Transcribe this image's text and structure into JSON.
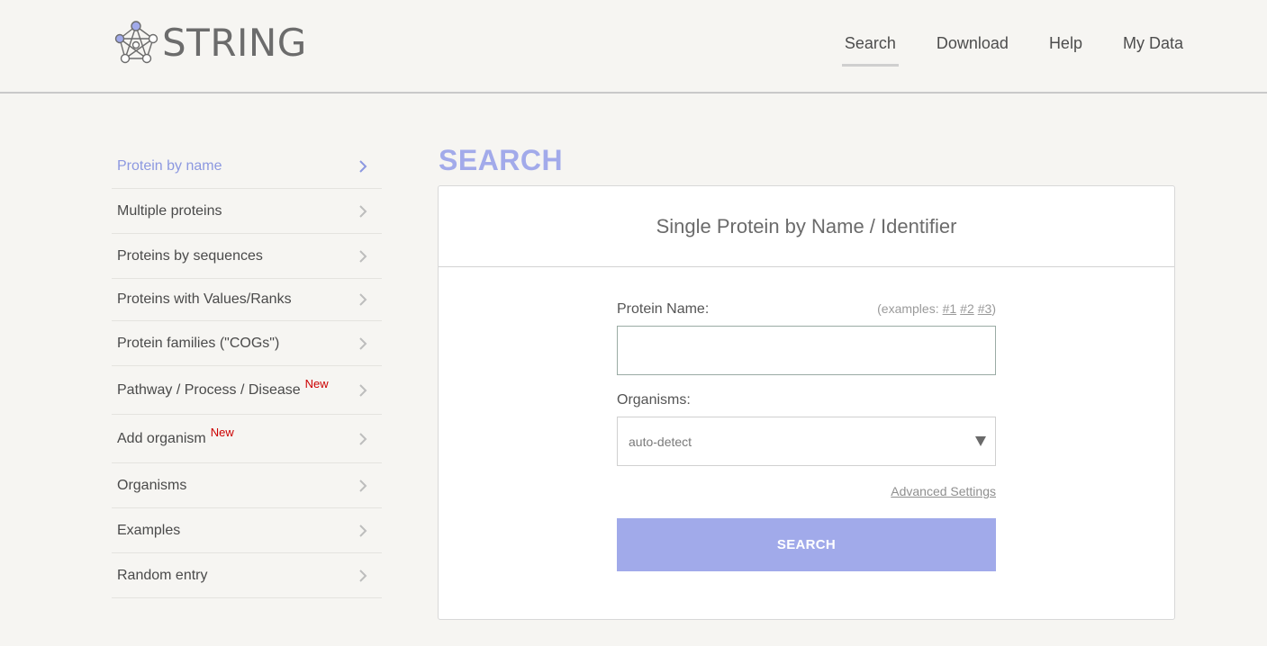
{
  "logo": {
    "text": "STRING"
  },
  "nav": [
    {
      "label": "Search",
      "active": true
    },
    {
      "label": "Download",
      "active": false
    },
    {
      "label": "Help",
      "active": false
    },
    {
      "label": "My Data",
      "active": false
    }
  ],
  "sidebar": {
    "items": [
      {
        "label": "Protein by name",
        "active": true,
        "badge": ""
      },
      {
        "label": "Multiple proteins",
        "active": false,
        "badge": ""
      },
      {
        "label": "Proteins by sequences",
        "active": false,
        "badge": ""
      },
      {
        "label": "Proteins with Values/Ranks",
        "active": false,
        "badge": ""
      },
      {
        "label": "Protein families (\"COGs\")",
        "active": false,
        "badge": ""
      },
      {
        "label": "Pathway / Process / Disease",
        "active": false,
        "badge": "New"
      },
      {
        "label": "Add organism",
        "active": false,
        "badge": "New"
      },
      {
        "label": "Organisms",
        "active": false,
        "badge": ""
      },
      {
        "label": "Examples",
        "active": false,
        "badge": ""
      },
      {
        "label": "Random entry",
        "active": false,
        "badge": ""
      }
    ]
  },
  "main": {
    "title": "SEARCH",
    "card_title": "Single Protein by Name / Identifier",
    "protein_label": "Protein Name:",
    "examples": {
      "prefix": "(examples:",
      "links": [
        "#1",
        "#2",
        "#3"
      ],
      "suffix": ")"
    },
    "protein_input": {
      "value": "",
      "placeholder": ""
    },
    "organisms_label": "Organisms:",
    "organisms_select": {
      "value": "auto-detect"
    },
    "advanced_settings": "Advanced Settings",
    "search_button": "SEARCH"
  },
  "colors": {
    "accent": "#a1aaea",
    "active_link": "#8c98e0",
    "new_badge": "#cc0000"
  }
}
